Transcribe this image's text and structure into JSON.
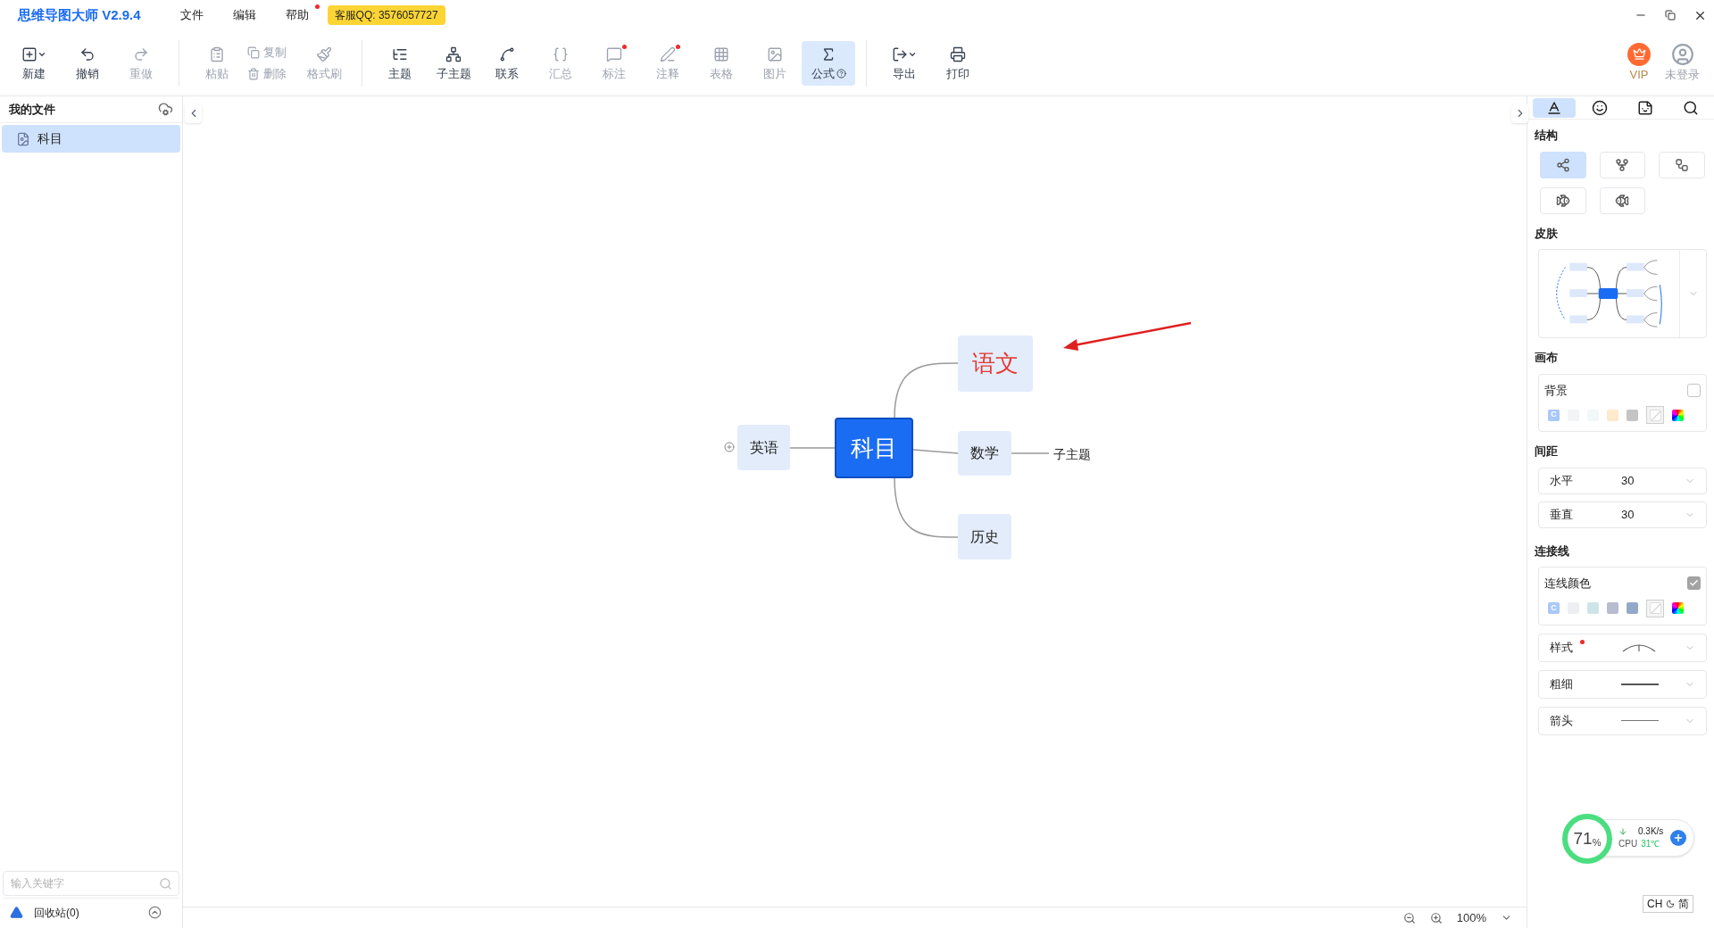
{
  "app": {
    "title": "思维导图大师 V2.9.4",
    "support": "客服QQ: 3576057727"
  },
  "menus": [
    {
      "label": "文件",
      "dot": false
    },
    {
      "label": "编辑",
      "dot": false
    },
    {
      "label": "帮助",
      "dot": true
    }
  ],
  "toolbar": [
    [
      {
        "label": "新建",
        "caret": true,
        "disabled": false,
        "dot": false,
        "selected": false
      },
      {
        "label": "撤销",
        "caret": false,
        "disabled": false,
        "dot": false,
        "selected": false
      },
      {
        "label": "重做",
        "caret": false,
        "disabled": true,
        "dot": false,
        "selected": false
      }
    ],
    [
      {
        "label": "粘贴",
        "caret": false,
        "disabled": true,
        "dot": false,
        "selected": false
      },
      {
        "label": "复制",
        "caret": false,
        "disabled": true,
        "dot": false,
        "selected": false
      },
      {
        "label": "删除",
        "caret": false,
        "disabled": true,
        "dot": false,
        "selected": false
      },
      {
        "label": "格式刷",
        "caret": false,
        "disabled": true,
        "dot": false,
        "selected": false
      }
    ],
    [
      {
        "label": "主题",
        "caret": false,
        "disabled": false,
        "dot": false,
        "selected": false
      },
      {
        "label": "子主题",
        "caret": false,
        "disabled": false,
        "dot": false,
        "selected": false
      },
      {
        "label": "联系",
        "caret": false,
        "disabled": false,
        "dot": false,
        "selected": false
      },
      {
        "label": "汇总",
        "caret": false,
        "disabled": true,
        "dot": false,
        "selected": false
      },
      {
        "label": "标注",
        "caret": false,
        "disabled": true,
        "dot": true,
        "selected": false
      },
      {
        "label": "注释",
        "caret": false,
        "disabled": true,
        "dot": true,
        "selected": false
      },
      {
        "label": "表格",
        "caret": false,
        "disabled": true,
        "dot": false,
        "selected": false
      },
      {
        "label": "图片",
        "caret": false,
        "disabled": true,
        "dot": false,
        "selected": false
      },
      {
        "label": "公式",
        "caret": false,
        "disabled": false,
        "dot": false,
        "selected": true
      }
    ],
    [
      {
        "label": "导出",
        "caret": true,
        "disabled": false,
        "dot": false,
        "selected": false
      },
      {
        "label": "打印",
        "caret": false,
        "disabled": false,
        "dot": false,
        "selected": false
      }
    ]
  ],
  "account": {
    "vip": "VIP",
    "login": "未登录"
  },
  "sidebar": {
    "title": "我的文件",
    "files": [
      {
        "name": "科目",
        "selected": true
      }
    ],
    "search": {
      "placeholder": "输入关键字"
    },
    "trash": "回收站(0)"
  },
  "mindmap": {
    "root": "科目",
    "right": [
      {
        "label": "语文",
        "color": "#e53935"
      },
      {
        "label": "数学",
        "color": "#222222",
        "children": [
          {
            "label": "子主题"
          }
        ]
      },
      {
        "label": "历史",
        "color": "#222222"
      }
    ],
    "left": [
      {
        "label": "英语",
        "color": "#222222",
        "collapsed": true
      }
    ]
  },
  "zoom": "100%",
  "panel": {
    "tabs": [
      {
        "selected": true
      },
      {
        "selected": false
      },
      {
        "selected": false
      },
      {
        "selected": false
      }
    ],
    "structure": {
      "title": "结构",
      "layouts": [
        {
          "selected": true
        },
        {
          "selected": false
        },
        {
          "selected": false
        },
        {
          "selected": false
        },
        {
          "selected": false
        }
      ]
    },
    "skin": {
      "title": "皮肤"
    },
    "canvas": {
      "title": "画布",
      "label": "背景",
      "checked": false,
      "swatches": [
        {
          "kind": "auto",
          "label": "C",
          "selected": false
        },
        {
          "kind": "color",
          "color": "#f3f4f6",
          "selected": false
        },
        {
          "kind": "color",
          "color": "#f2f7f7",
          "selected": false
        },
        {
          "kind": "color",
          "color": "#fde9cc",
          "selected": false
        },
        {
          "kind": "color",
          "color": "#c4c4c4",
          "selected": false
        },
        {
          "kind": "none",
          "selected": true
        },
        {
          "kind": "picker",
          "selected": false
        }
      ]
    },
    "spacing": {
      "title": "间距",
      "fields": [
        {
          "label": "水平",
          "value": "30"
        },
        {
          "label": "垂直",
          "value": "30"
        }
      ]
    },
    "lines": {
      "title": "连接线",
      "label": "连线颜色",
      "checked": true,
      "swatches": [
        {
          "kind": "auto",
          "label": "C",
          "selected": false
        },
        {
          "kind": "color",
          "color": "#eeeff4",
          "selected": false
        },
        {
          "kind": "color",
          "color": "#cde5e8",
          "selected": false
        },
        {
          "kind": "color",
          "color": "#b8bccf",
          "selected": false
        },
        {
          "kind": "color",
          "color": "#94a9c8",
          "selected": false
        },
        {
          "kind": "none",
          "selected": true
        },
        {
          "kind": "picker",
          "selected": false
        }
      ],
      "options": [
        {
          "kind": "style",
          "label": "样式",
          "dot": true
        },
        {
          "kind": "thickness",
          "label": "粗细",
          "dot": false
        },
        {
          "kind": "arrow",
          "label": "箭头",
          "dot": false
        }
      ]
    }
  },
  "monitor": {
    "percent": "71",
    "unit": "%",
    "speed": "0.3K/s",
    "cpu": "CPU",
    "temp": "31℃"
  },
  "ime": {
    "lang": "CH",
    "mode": "简"
  }
}
